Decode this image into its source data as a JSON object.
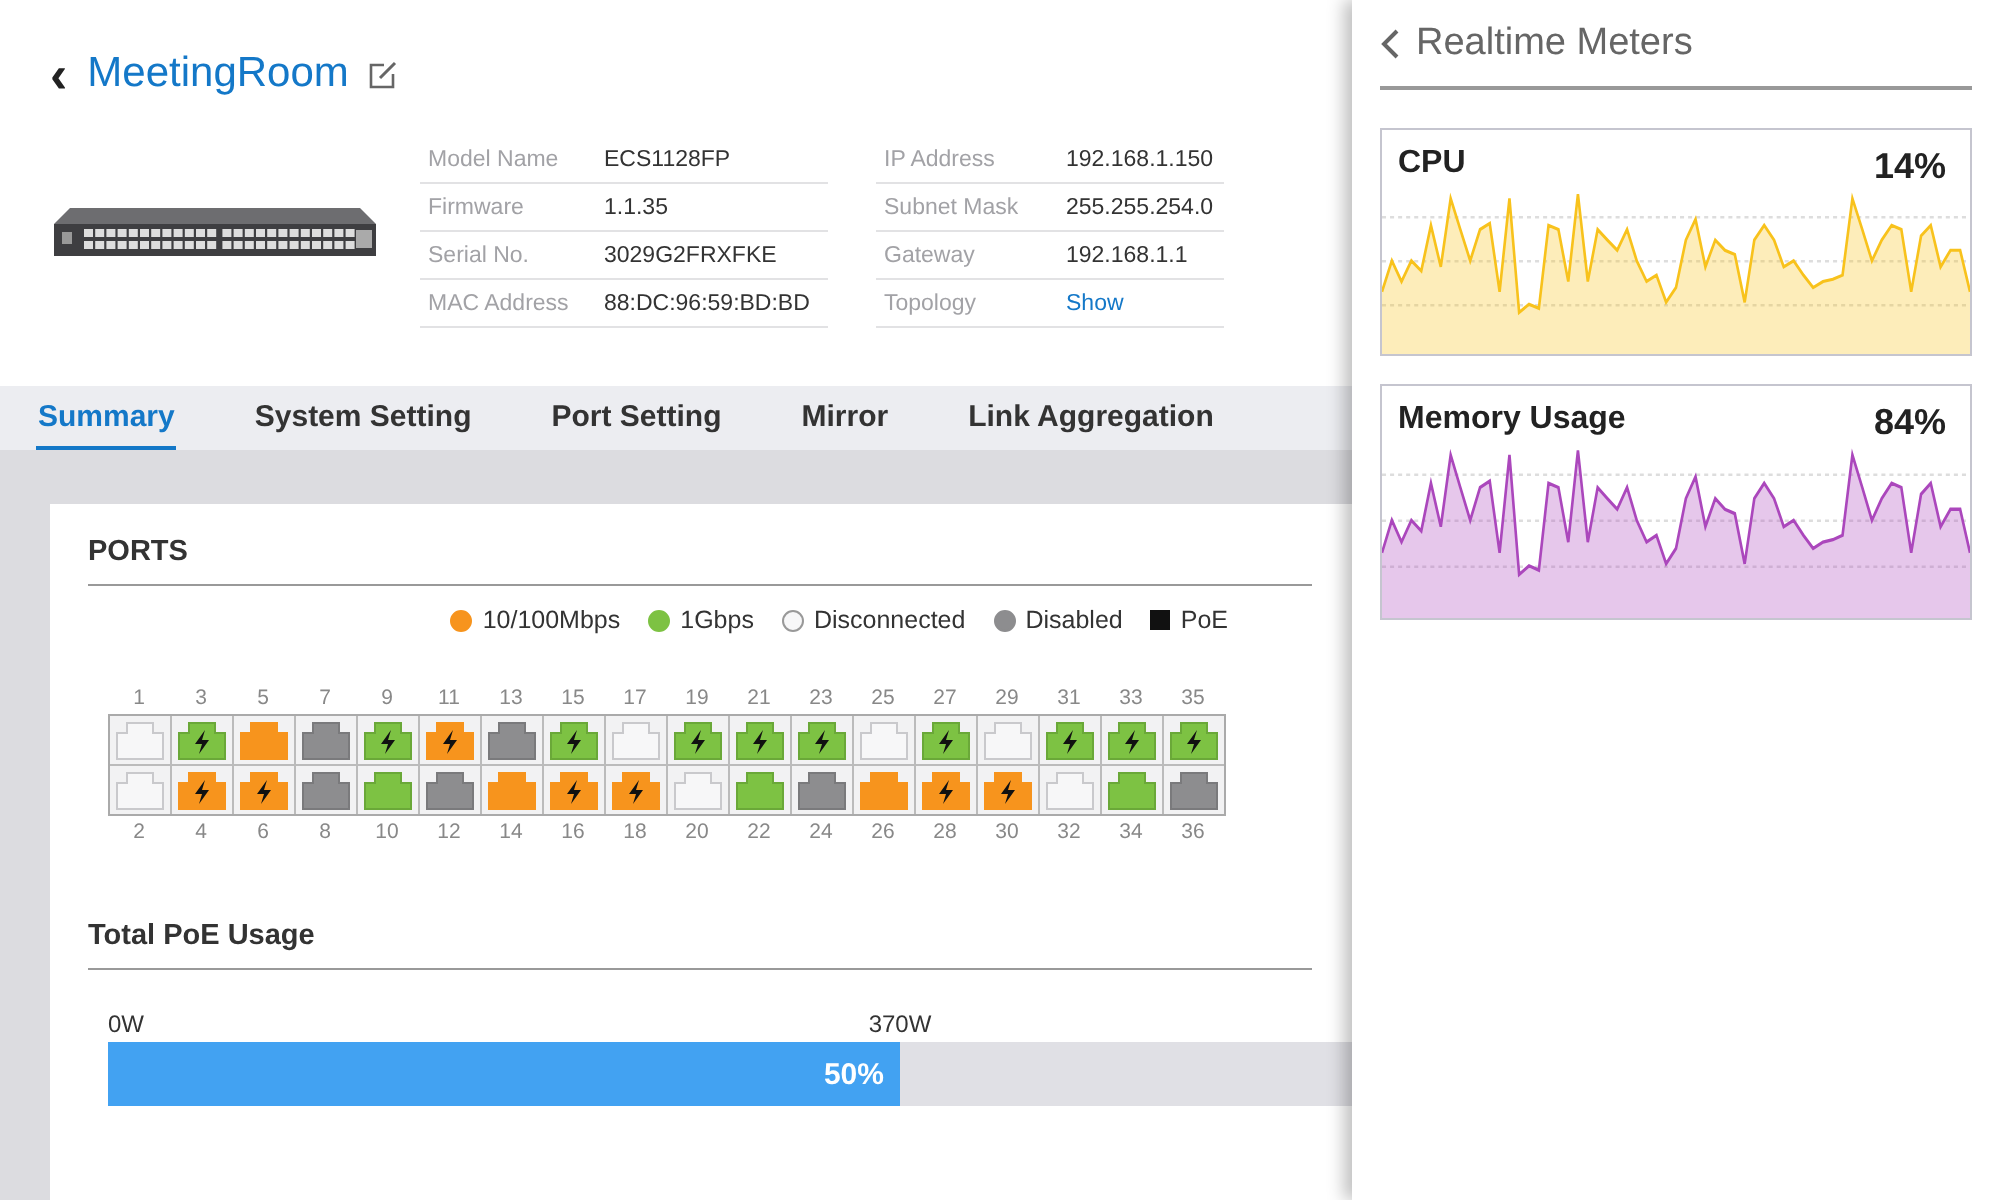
{
  "header": {
    "back": "‹",
    "title": "MeetingRoom"
  },
  "info_left": [
    {
      "label": "Model Name",
      "value": "ECS1128FP"
    },
    {
      "label": "Firmware",
      "value": "1.1.35"
    },
    {
      "label": "Serial No.",
      "value": "3029G2FRXFKE"
    },
    {
      "label": "MAC Address",
      "value": "88:DC:96:59:BD:BD"
    }
  ],
  "info_right": [
    {
      "label": "IP Address",
      "value": "192.168.1.150",
      "kind": "text"
    },
    {
      "label": "Subnet Mask",
      "value": "255.255.254.0",
      "kind": "text"
    },
    {
      "label": "Gateway",
      "value": "192.168.1.1",
      "kind": "text"
    },
    {
      "label": "Topology",
      "value": "Show",
      "kind": "link"
    }
  ],
  "tabs": [
    {
      "label": "Summary",
      "selected": true
    },
    {
      "label": "System Setting",
      "selected": false
    },
    {
      "label": "Port Setting",
      "selected": false
    },
    {
      "label": "Mirror",
      "selected": false
    },
    {
      "label": "Link Aggregation",
      "selected": false
    }
  ],
  "ports_title": "PORTS",
  "legend": [
    {
      "kind": "fast",
      "label": "10/100Mbps"
    },
    {
      "kind": "gigabit",
      "label": "1Gbps"
    },
    {
      "kind": "disconnected",
      "label": "Disconnected"
    },
    {
      "kind": "disabled",
      "label": "Disabled"
    },
    {
      "kind": "poe",
      "label": "PoE"
    }
  ],
  "ports_top": [
    {
      "number": "1",
      "kind": "disconnected",
      "poe": false
    },
    {
      "number": "3",
      "kind": "gigabit",
      "poe": true
    },
    {
      "number": "5",
      "kind": "fast",
      "poe": false
    },
    {
      "number": "7",
      "kind": "disabled",
      "poe": false
    },
    {
      "number": "9",
      "kind": "gigabit",
      "poe": true
    },
    {
      "number": "11",
      "kind": "fast",
      "poe": true
    },
    {
      "number": "13",
      "kind": "disabled",
      "poe": false
    },
    {
      "number": "15",
      "kind": "gigabit",
      "poe": true
    },
    {
      "number": "17",
      "kind": "disconnected",
      "poe": false
    },
    {
      "number": "19",
      "kind": "gigabit",
      "poe": true
    },
    {
      "number": "21",
      "kind": "gigabit",
      "poe": true
    },
    {
      "number": "23",
      "kind": "gigabit",
      "poe": true
    },
    {
      "number": "25",
      "kind": "disconnected",
      "poe": false
    },
    {
      "number": "27",
      "kind": "gigabit",
      "poe": true
    },
    {
      "number": "29",
      "kind": "disconnected",
      "poe": false
    },
    {
      "number": "31",
      "kind": "gigabit",
      "poe": true
    },
    {
      "number": "33",
      "kind": "gigabit",
      "poe": true
    },
    {
      "number": "35",
      "kind": "gigabit",
      "poe": true
    }
  ],
  "ports_bottom": [
    {
      "number": "2",
      "kind": "disconnected",
      "poe": false
    },
    {
      "number": "4",
      "kind": "fast",
      "poe": true
    },
    {
      "number": "6",
      "kind": "fast",
      "poe": true
    },
    {
      "number": "8",
      "kind": "disabled",
      "poe": false
    },
    {
      "number": "10",
      "kind": "gigabit",
      "poe": false
    },
    {
      "number": "12",
      "kind": "disabled",
      "poe": false
    },
    {
      "number": "14",
      "kind": "fast",
      "poe": false
    },
    {
      "number": "16",
      "kind": "fast",
      "poe": true
    },
    {
      "number": "18",
      "kind": "fast",
      "poe": true
    },
    {
      "number": "20",
      "kind": "disconnected",
      "poe": false
    },
    {
      "number": "22",
      "kind": "gigabit",
      "poe": false
    },
    {
      "number": "24",
      "kind": "disabled",
      "poe": false
    },
    {
      "number": "26",
      "kind": "fast",
      "poe": false
    },
    {
      "number": "28",
      "kind": "fast",
      "poe": true
    },
    {
      "number": "30",
      "kind": "fast",
      "poe": true
    },
    {
      "number": "32",
      "kind": "disconnected",
      "poe": false
    },
    {
      "number": "34",
      "kind": "gigabit",
      "poe": false
    },
    {
      "number": "36",
      "kind": "disabled",
      "poe": false
    }
  ],
  "poe_usage": {
    "title": "Total PoE Usage",
    "min_label": "0W",
    "max_label": "370W",
    "level": 0.5,
    "reading": "50%"
  },
  "meters_panel": {
    "title": "Realtime Meters",
    "meters": [
      {
        "name": "CPU",
        "reading": "14%",
        "color": "#f8c21c"
      },
      {
        "name": "Memory Usage",
        "reading": "84%",
        "color": "#ab47bc"
      }
    ]
  }
}
